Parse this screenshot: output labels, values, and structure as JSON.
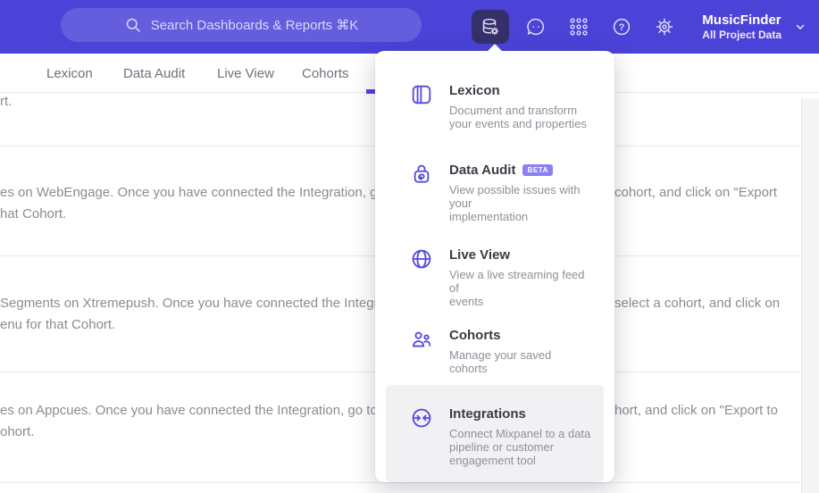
{
  "topbar": {
    "search_placeholder": "Search Dashboards & Reports ⌘K",
    "project_name": "MusicFinder",
    "project_scope": "All Project Data"
  },
  "nav": {
    "tabs": [
      {
        "label": "Lexicon"
      },
      {
        "label": "Data Audit"
      },
      {
        "label": "Live View"
      },
      {
        "label": "Cohorts"
      }
    ]
  },
  "menu": {
    "items": [
      {
        "title": "Lexicon",
        "desc": "Document and transform\nyour events and properties"
      },
      {
        "title": "Data Audit",
        "badge": "BETA",
        "desc": "View possible issues with your\nimplementation"
      },
      {
        "title": "Live View",
        "desc": "View a live streaming feed of\nevents"
      },
      {
        "title": "Cohorts",
        "desc": "Manage your saved cohorts"
      },
      {
        "title": "Integrations",
        "desc": "Connect Mixpanel to a data\npipeline or customer\nengagement tool"
      }
    ]
  },
  "content": {
    "rows": [
      {
        "l1": "rt."
      },
      {
        "l1": "es on WebEngage. Once you have connected the Integration, go to the",
        "r1": "cohort, and click on \"Export",
        "l2": "hat Cohort."
      },
      {
        "l1": "Segments on Xtremepush. Once you have connected the Integration,",
        "r1": "select a cohort, and click on",
        "l2": "enu for that Cohort."
      },
      {
        "l1": "es on Appcues. Once you have connected the Integration, go to the M",
        "r1": "hort, and click on \"Export to",
        "l2": "ohort."
      }
    ]
  },
  "colors": {
    "topbar": "#4b43d8",
    "accent": "#4f44e0",
    "badge": "#8b80f0",
    "highlight": "#f1f1f3"
  }
}
